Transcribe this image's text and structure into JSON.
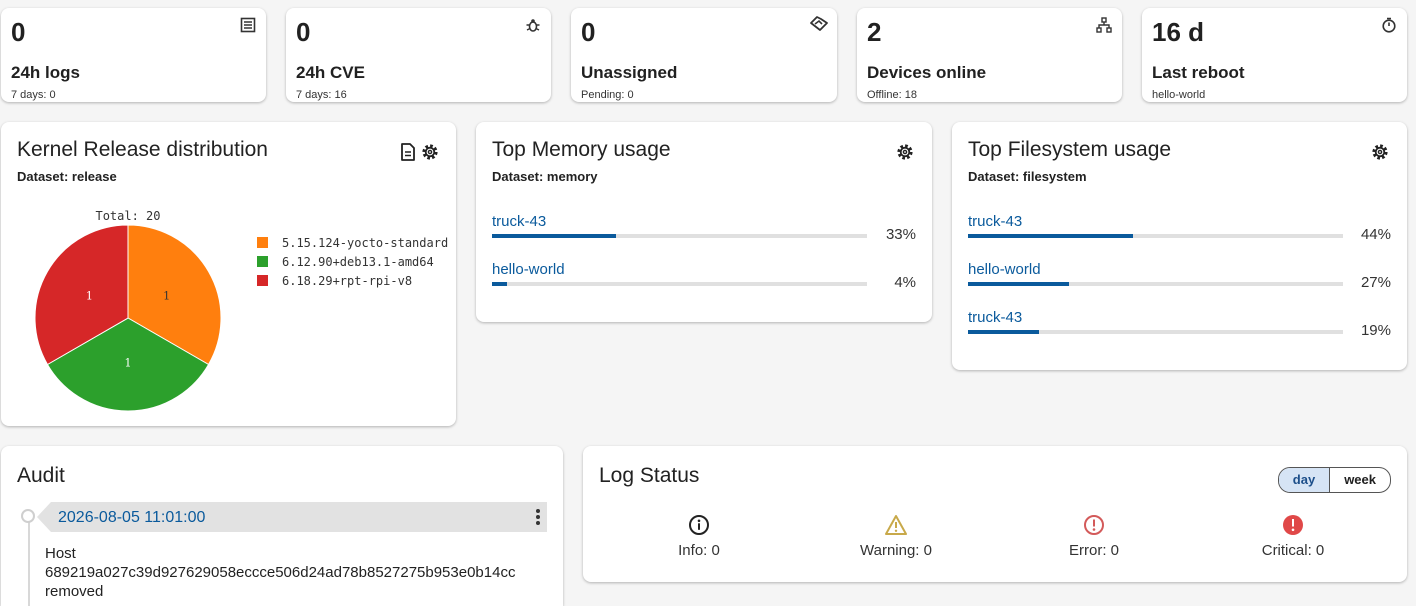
{
  "stats": [
    {
      "value": "0",
      "label": "24h logs",
      "sub": "7 days: 0",
      "icon": "list-icon"
    },
    {
      "value": "0",
      "label": "24h CVE",
      "sub": "7 days: 16",
      "icon": "bug-icon"
    },
    {
      "value": "0",
      "label": "Unassigned",
      "sub": "Pending: 0",
      "icon": "handshake-icon"
    },
    {
      "value": "2",
      "label": "Devices online",
      "sub": "Offline: 18",
      "icon": "network-icon"
    },
    {
      "value": "16 d",
      "label": "Last reboot",
      "sub": "hello-world",
      "icon": "timer-icon"
    }
  ],
  "kernel": {
    "title": "Kernel Release distribution",
    "dataset": "Dataset: release",
    "chart_data": {
      "type": "pie",
      "title": "Total: 20",
      "categories": [
        "5.15.124-yocto-standard",
        "6.12.90+deb13.1-amd64",
        "6.18.29+rpt-rpi-v8"
      ],
      "values": [
        1,
        1,
        1
      ],
      "colors": [
        "#ff7f0e",
        "#2ca02c",
        "#d62728"
      ],
      "legend": "right"
    }
  },
  "memory": {
    "title": "Top Memory usage",
    "dataset": "Dataset: memory",
    "rows": [
      {
        "host": "truck-43",
        "percent": 33,
        "label": "33%"
      },
      {
        "host": "hello-world",
        "percent": 4,
        "label": "4%"
      }
    ]
  },
  "filesystem": {
    "title": "Top Filesystem usage",
    "dataset": "Dataset: filesystem",
    "rows": [
      {
        "host": "truck-43",
        "percent": 44,
        "label": "44%"
      },
      {
        "host": "hello-world",
        "percent": 27,
        "label": "27%"
      },
      {
        "host": "truck-43",
        "percent": 19,
        "label": "19%"
      }
    ]
  },
  "audit": {
    "title": "Audit",
    "entry_time": "2026-08-05 11:01:00",
    "entry_line1": "Host",
    "entry_line2": "689219a027c39d927629058eccce506d24ad78b8527275b953e0b14cc",
    "entry_line3": "removed"
  },
  "logstatus": {
    "title": "Log Status",
    "toggle": {
      "day": "day",
      "week": "week",
      "selected": "day"
    },
    "items": [
      {
        "label": "Info: 0",
        "icon": "info-icon",
        "color": "#222222"
      },
      {
        "label": "Warning: 0",
        "icon": "warning-icon",
        "color": "#c8a94a"
      },
      {
        "label": "Error: 0",
        "icon": "error-icon",
        "color": "#d35a5a"
      },
      {
        "label": "Critical: 0",
        "icon": "critical-icon",
        "color": "#e04848"
      }
    ]
  },
  "colors": {
    "accent": "#0a5a9c"
  }
}
